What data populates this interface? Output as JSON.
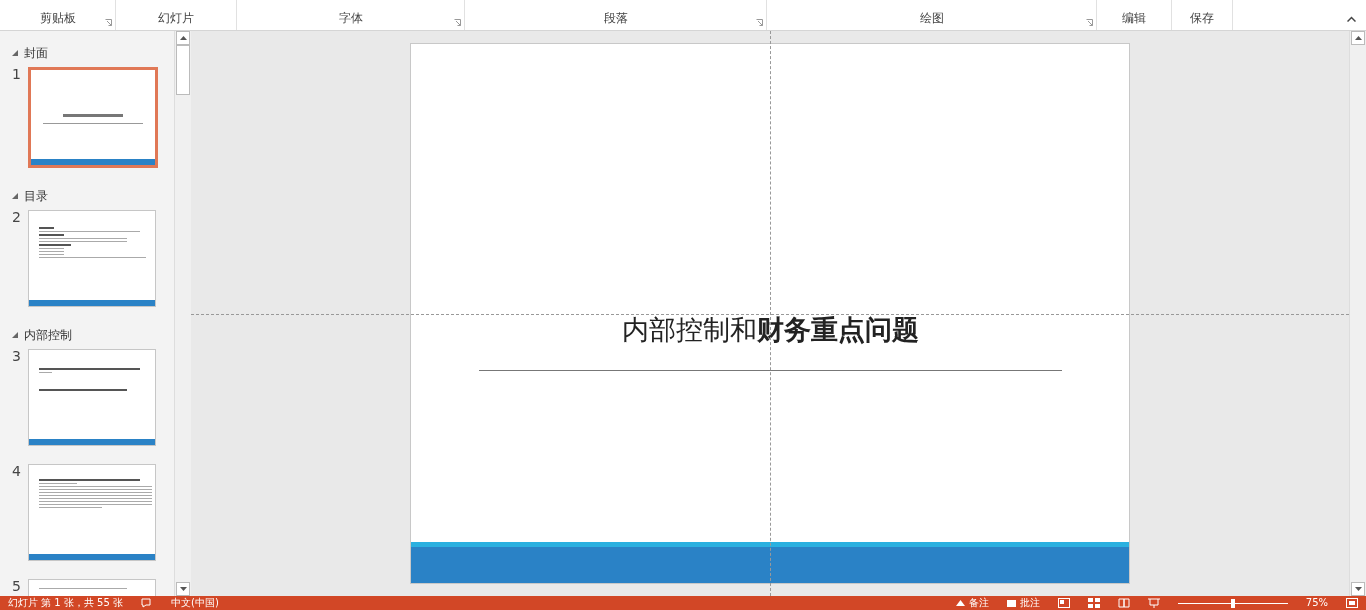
{
  "ribbon": {
    "groups": [
      {
        "label": "剪贴板",
        "launcher": true
      },
      {
        "label": "幻灯片",
        "launcher": false
      },
      {
        "label": "字体",
        "launcher": true
      },
      {
        "label": "段落",
        "launcher": true
      },
      {
        "label": "绘图",
        "launcher": true
      },
      {
        "label": "编辑",
        "launcher": false
      },
      {
        "label": "保存",
        "launcher": false
      }
    ]
  },
  "sidebar": {
    "sections": [
      {
        "title": "封面",
        "expanded": true,
        "slides": [
          {
            "number": "1",
            "selected": true,
            "kind": "title"
          }
        ]
      },
      {
        "title": "目录",
        "expanded": true,
        "slides": [
          {
            "number": "2",
            "selected": false,
            "kind": "toc"
          }
        ]
      },
      {
        "title": "内部控制",
        "expanded": true,
        "slides": [
          {
            "number": "3",
            "selected": false,
            "kind": "section"
          },
          {
            "number": "4",
            "selected": false,
            "kind": "text"
          },
          {
            "number": "5",
            "selected": false,
            "kind": "partial"
          }
        ]
      }
    ]
  },
  "slide": {
    "title": "内部控制和**财务重点问题**"
  },
  "status_bar": {
    "slide_info": "幻灯片 第 1 张，共 55 张",
    "language": "中文(中国)",
    "notes": "备注",
    "comments": "批注",
    "zoom": "75%",
    "zoom_slider": {
      "level": 0.5
    }
  }
}
